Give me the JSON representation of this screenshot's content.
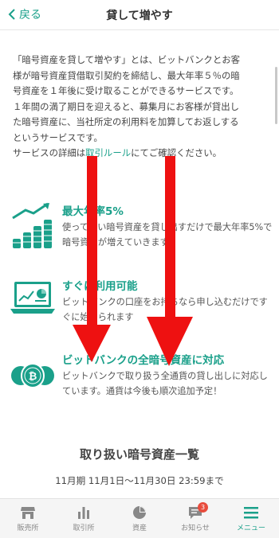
{
  "header": {
    "back_label": "戻る",
    "title": "貸して増やす"
  },
  "intro": {
    "lines": [
      "「暗号資産を貸して増やす」とは、ビットバンクとお客",
      "様が暗号資産貸借取引契約を締結し、最大年率５％の暗",
      "号資産を１年後に受け取ることができるサービスです。",
      "１年間の満了期日を迎えると、募集月にお客様が貸出し",
      "た暗号資産に、当社所定の利用料を加算してお返しする",
      "というサービスです。"
    ],
    "last_prefix": "サービスの詳細は",
    "last_link": "取引ルール",
    "last_suffix": "にてご確認ください。"
  },
  "features": [
    {
      "icon": "coins-growth-icon",
      "title": "最大年率5%",
      "desc": "使ってない暗号資産を貸し出すだけで最大年率5%で暗号資産が増えていきます"
    },
    {
      "icon": "laptop-chart-icon",
      "title": "すぐに利用可能",
      "desc": "ビットバンクの口座をお持ちなら申し込むだけですぐに始められます"
    },
    {
      "icon": "crypto-coins-icon",
      "title": "ビットバンクの全暗号資産に対応",
      "desc": "ビットバンクで取り扱う全通貨の貸し出しに対応しています。通貨は今後も順次追加予定！"
    }
  ],
  "section": {
    "title": "取り扱い暗号資産一覧",
    "period": "11月期 11月1日〜11月30日 23:59まで"
  },
  "nav": [
    {
      "label": "販売所",
      "icon": "shop-icon"
    },
    {
      "label": "取引所",
      "icon": "bar-chart-icon"
    },
    {
      "label": "資産",
      "icon": "pie-chart-icon"
    },
    {
      "label": "お知らせ",
      "icon": "message-icon",
      "badge": "3"
    },
    {
      "label": "メニュー",
      "icon": "menu-icon"
    }
  ],
  "colors": {
    "accent": "#1aa08a",
    "arrow": "#ee1111",
    "badge": "#e84c3d"
  }
}
